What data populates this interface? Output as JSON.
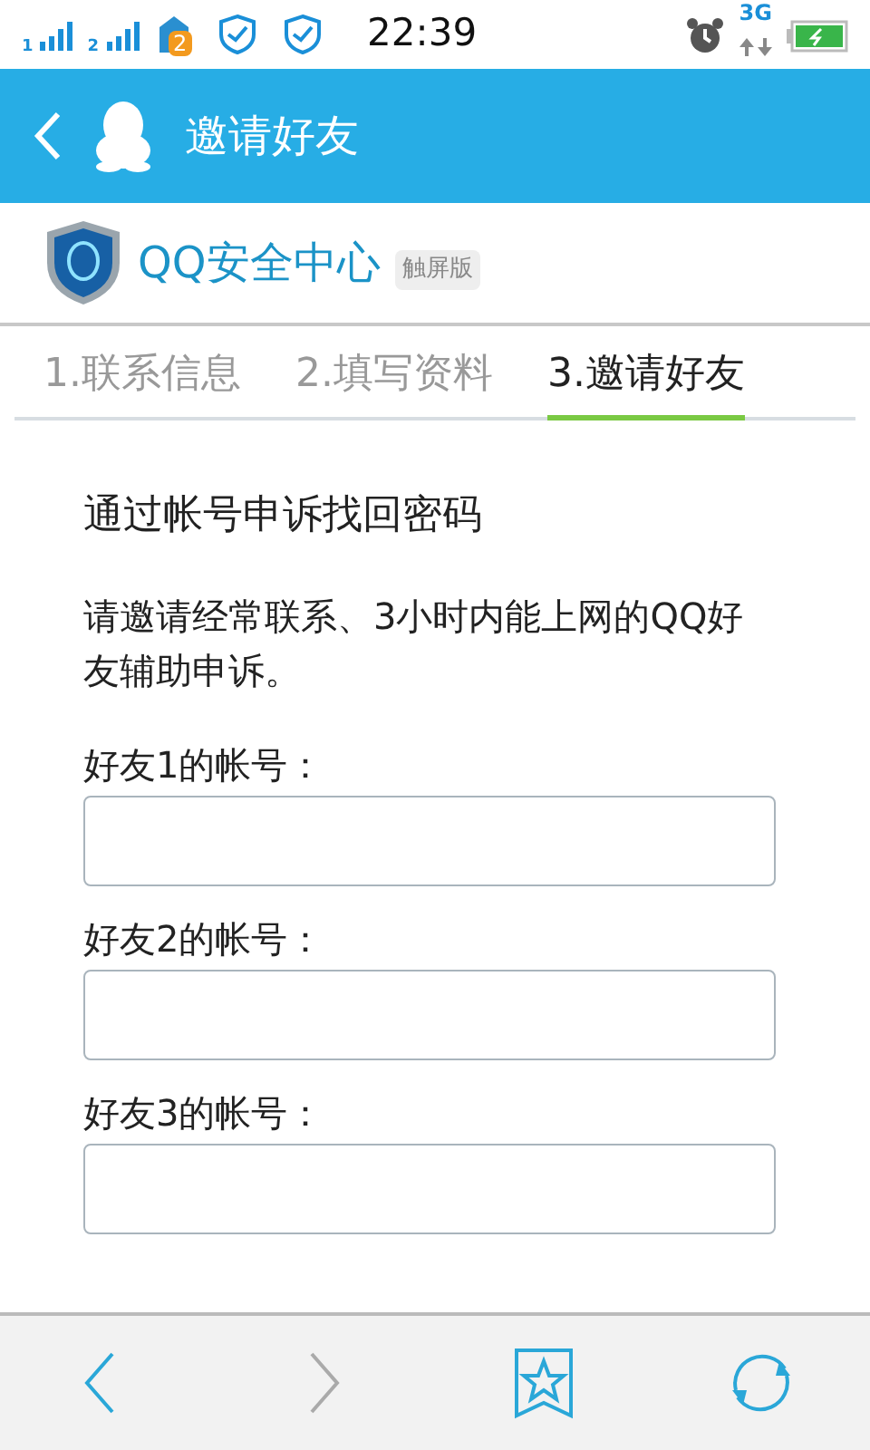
{
  "status_bar": {
    "sim_slots": [
      "1",
      "2"
    ],
    "notification_count": "2",
    "time": "22:39",
    "network": "3G"
  },
  "header": {
    "title": "邀请好友"
  },
  "brand": {
    "name": "QQ安全中心",
    "tag": "触屏版"
  },
  "tabs": [
    {
      "label": "1.联系信息",
      "selected": false
    },
    {
      "label": "2.填写资料",
      "selected": false
    },
    {
      "label": "3.邀请好友",
      "selected": true
    }
  ],
  "content": {
    "heading": "通过帐号申诉找回密码",
    "description": "请邀请经常联系、3小时内能上网的QQ好友辅助申诉。",
    "fields": [
      {
        "label": "好友1的帐号："
      },
      {
        "label": "好友2的帐号："
      },
      {
        "label": "好友3的帐号："
      }
    ]
  },
  "toolbar": [
    {
      "kind": "back",
      "disabled": false
    },
    {
      "kind": "forward",
      "disabled": true
    },
    {
      "kind": "bookmark",
      "disabled": false
    },
    {
      "kind": "refresh",
      "disabled": false
    }
  ]
}
